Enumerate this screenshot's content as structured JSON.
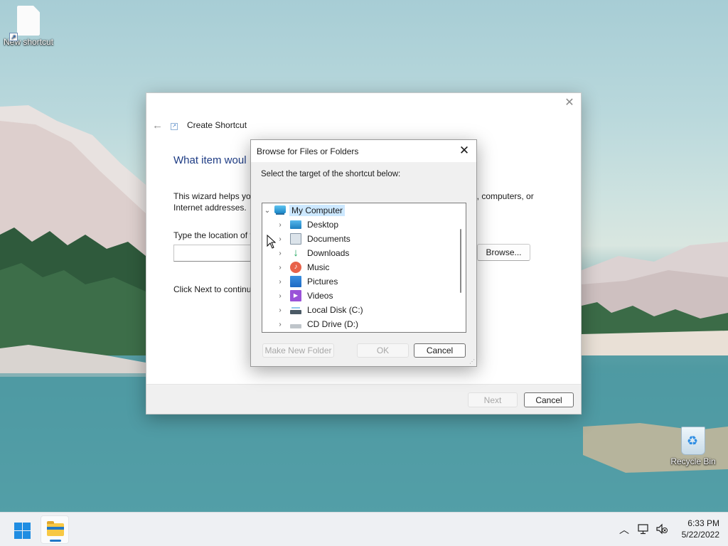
{
  "desktop": {
    "icons": [
      {
        "label": "New shortcut",
        "icon": "shortcut-file-icon"
      },
      {
        "label": "Recycle Bin",
        "icon": "recycle-bin-icon"
      }
    ]
  },
  "wizard": {
    "title": "Create Shortcut",
    "heading": "What item woul",
    "description_left": "This wizard helps you Internet addresses.",
    "description_right": "ers, computers, or",
    "location_label": "Type the location of t",
    "location_value": "",
    "browse_label": "Browse...",
    "continue_text": "Click Next to continu",
    "next_label": "Next",
    "cancel_label": "Cancel",
    "icons": {
      "back": "back-arrow-icon",
      "close": "close-icon",
      "shortcut": "shortcut-icon"
    }
  },
  "browse_dialog": {
    "title": "Browse for Files or Folders",
    "instruction": "Select the target of the shortcut below:",
    "tree": [
      {
        "label": "My Computer",
        "icon": "computer-icon",
        "expanded": true,
        "selected": true,
        "level": 0
      },
      {
        "label": "Desktop",
        "icon": "desktop-folder-icon",
        "level": 1
      },
      {
        "label": "Documents",
        "icon": "documents-folder-icon",
        "level": 1
      },
      {
        "label": "Downloads",
        "icon": "downloads-folder-icon",
        "level": 1
      },
      {
        "label": "Music",
        "icon": "music-folder-icon",
        "level": 1
      },
      {
        "label": "Pictures",
        "icon": "pictures-folder-icon",
        "level": 1
      },
      {
        "label": "Videos",
        "icon": "videos-folder-icon",
        "level": 1
      },
      {
        "label": "Local Disk (C:)",
        "icon": "local-disk-icon",
        "level": 1
      },
      {
        "label": "CD Drive (D:)",
        "icon": "cd-drive-icon",
        "level": 1
      }
    ],
    "new_folder_label": "Make New Folder",
    "ok_label": "OK",
    "cancel_label": "Cancel"
  },
  "taskbar": {
    "time": "6:33 PM",
    "date": "5/22/2022",
    "icons": [
      "start-icon",
      "file-explorer-icon",
      "show-hidden-icons-chevron",
      "network-icon",
      "volume-muted-icon"
    ]
  },
  "colors": {
    "accent": "#0067c0",
    "selection": "#cce8ff",
    "heading": "#1e3c84",
    "taskbar": "#eef0f3"
  }
}
